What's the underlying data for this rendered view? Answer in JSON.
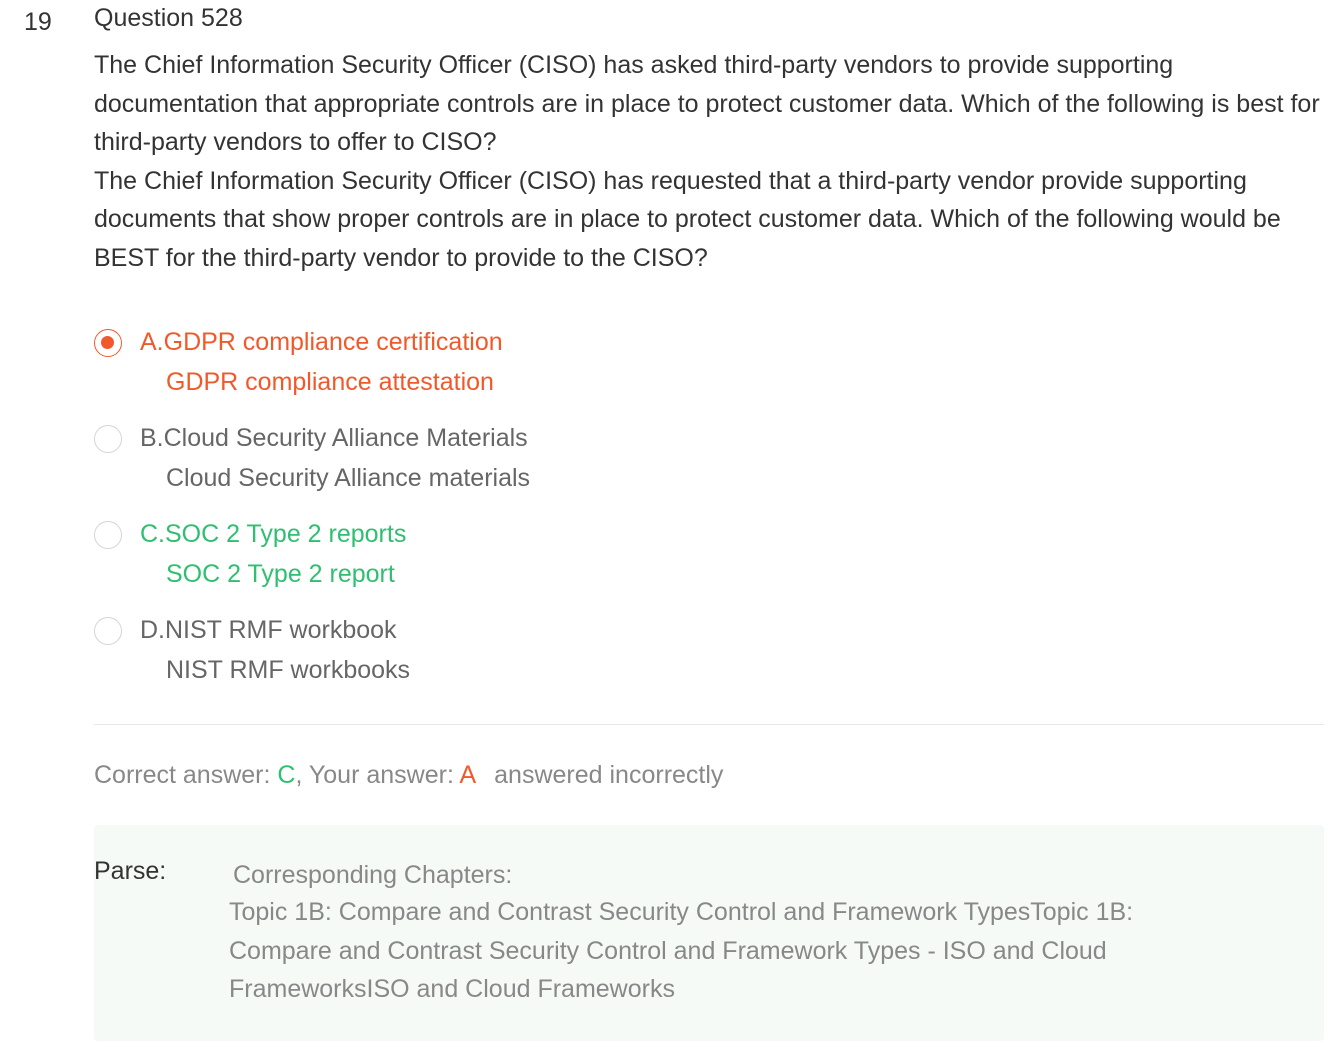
{
  "question": {
    "index": "19",
    "title": "Question 528",
    "stem": [
      "The Chief Information Security Officer (CISO) has asked third-party vendors to provide supporting documentation that appropriate controls are in place to protect customer data. Which of the following is best for third-party vendors to offer to CISO?",
      "The Chief Information Security Officer (CISO) has requested that a third-party vendor provide supporting documents that show proper controls are in place to protect customer data. Which of the following would be BEST for the third-party vendor to provide to the CISO?"
    ]
  },
  "options": [
    {
      "line1": "A.GDPR compliance certification",
      "line2": "GDPR compliance attestation",
      "state": "selected-wrong"
    },
    {
      "line1": "B.Cloud Security Alliance Materials",
      "line2": "Cloud Security Alliance materials",
      "state": "neutral"
    },
    {
      "line1": "C.SOC 2 Type 2 reports",
      "line2": "SOC 2 Type 2 report",
      "state": "correct"
    },
    {
      "line1": "D.NIST RMF workbook",
      "line2": "NIST RMF workbooks",
      "state": "neutral"
    }
  ],
  "result": {
    "correct_label": "Correct answer: ",
    "correct_value": "C",
    "separator": ", Your answer: ",
    "your_value": "A",
    "status": "answered incorrectly"
  },
  "parse": {
    "label": "Parse:",
    "heading": "Corresponding Chapters:",
    "text": "Topic 1B: Compare and Contrast Security Control and Framework TypesTopic 1B: Compare and Contrast Security Control and Framework Types - ISO and Cloud FrameworksISO and Cloud Frameworks"
  },
  "colors": {
    "wrong": "#f2592a",
    "correct": "#2fbf71",
    "neutral": "#666666",
    "parse_bg": "#f5faf6"
  }
}
